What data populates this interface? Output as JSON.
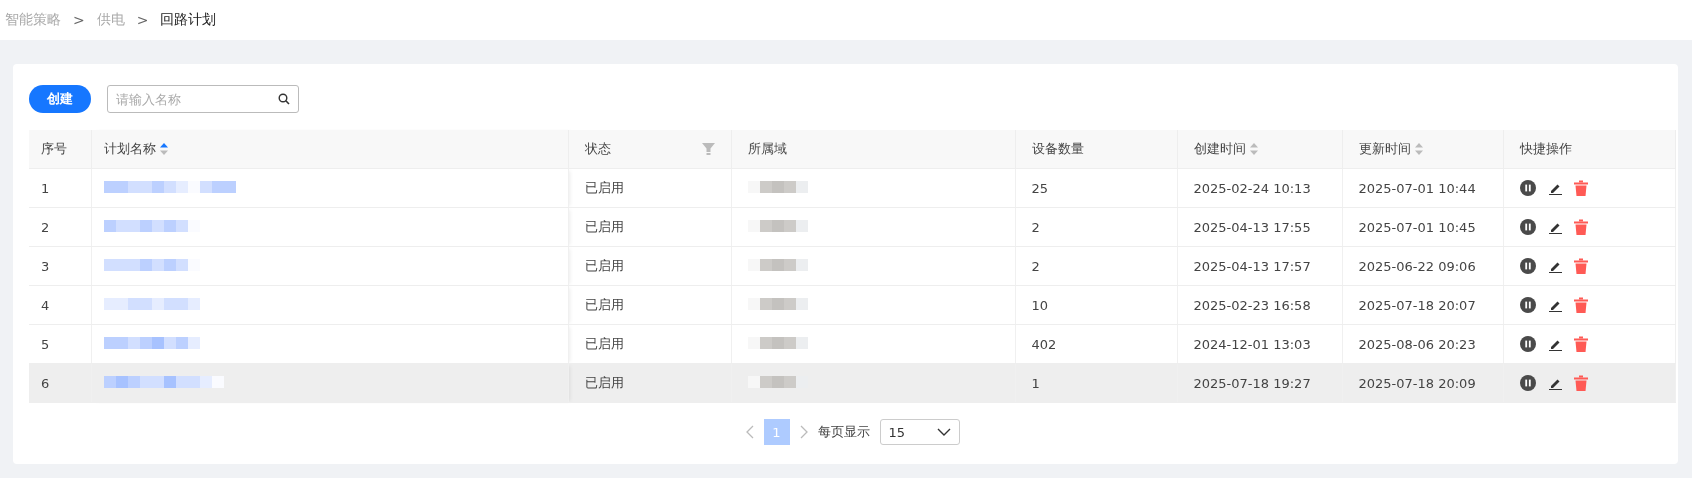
{
  "breadcrumb": [
    {
      "label": "智能策略",
      "current": false
    },
    {
      "label": "供电",
      "current": false
    },
    {
      "label": "回路计划",
      "current": true
    }
  ],
  "breadcrumb_separator": ">",
  "toolbar": {
    "create_button": "创建",
    "search": {
      "placeholder": "请输入名称"
    }
  },
  "table": {
    "columns": [
      {
        "label": "序号",
        "kind": "plain"
      },
      {
        "label": "计划名称",
        "kind": "sort",
        "sorted_ascending": true
      },
      {
        "label": "状态",
        "kind": "filter"
      },
      {
        "label": "所属域",
        "kind": "plain"
      },
      {
        "label": "设备数量",
        "kind": "plain"
      },
      {
        "label": "创建时间",
        "kind": "sort",
        "sorted_ascending": false
      },
      {
        "label": "更新时间",
        "kind": "sort",
        "sorted_ascending": false
      },
      {
        "label": "快捷操作",
        "kind": "plain"
      }
    ],
    "rows": [
      {
        "index": "1",
        "name_redacted": true,
        "status": "已启用",
        "domain_redacted": true,
        "devices": "25",
        "created": "2025-02-24 10:13",
        "updated": "2025-07-01 10:44",
        "hovered": false
      },
      {
        "index": "2",
        "name_redacted": true,
        "status": "已启用",
        "domain_redacted": true,
        "devices": "2",
        "created": "2025-04-13 17:55",
        "updated": "2025-07-01 10:45",
        "hovered": false
      },
      {
        "index": "3",
        "name_redacted": true,
        "status": "已启用",
        "domain_redacted": true,
        "devices": "2",
        "created": "2025-04-13 17:57",
        "updated": "2025-06-22 09:06",
        "hovered": false
      },
      {
        "index": "4",
        "name_redacted": true,
        "status": "已启用",
        "domain_redacted": true,
        "devices": "10",
        "created": "2025-02-23 16:58",
        "updated": "2025-07-18 20:07",
        "hovered": false
      },
      {
        "index": "5",
        "name_redacted": true,
        "status": "已启用",
        "domain_redacted": true,
        "devices": "402",
        "created": "2024-12-01 13:03",
        "updated": "2025-08-06 20:23",
        "hovered": false
      },
      {
        "index": "6",
        "name_redacted": true,
        "status": "已启用",
        "domain_redacted": true,
        "devices": "1",
        "created": "2025-07-18 19:27",
        "updated": "2025-07-18 20:09",
        "hovered": true
      }
    ]
  },
  "pagination": {
    "pages": [
      {
        "label": "1",
        "selected": true
      }
    ],
    "page_size_label": "每页显示",
    "page_size": "15"
  }
}
